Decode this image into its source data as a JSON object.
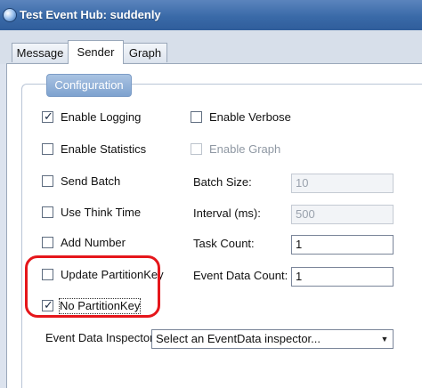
{
  "window": {
    "title": "Test Event Hub: suddenly",
    "icon": "app-globe-icon"
  },
  "tabs": [
    {
      "label": "Message",
      "active": false
    },
    {
      "label": "Sender",
      "active": true
    },
    {
      "label": "Graph",
      "active": false
    }
  ],
  "configuration": {
    "header": "Configuration",
    "left_checkboxes": [
      {
        "label": "Enable Logging",
        "checked": true,
        "enabled": true
      },
      {
        "label": "Enable Statistics",
        "checked": false,
        "enabled": true
      },
      {
        "label": "Send Batch",
        "checked": false,
        "enabled": true
      },
      {
        "label": "Use Think Time",
        "checked": false,
        "enabled": true
      },
      {
        "label": "Add Number",
        "checked": false,
        "enabled": true
      },
      {
        "label": "Update PartitionKey",
        "checked": false,
        "enabled": true
      },
      {
        "label": "No PartitionKey",
        "checked": true,
        "enabled": true
      }
    ],
    "right_checkboxes": [
      {
        "label": "Enable Verbose",
        "checked": false,
        "enabled": true
      },
      {
        "label": "Enable Graph",
        "checked": false,
        "enabled": false
      }
    ],
    "fields": [
      {
        "label": "Batch Size:",
        "value": "10",
        "enabled": false
      },
      {
        "label": "Interval (ms):",
        "value": "500",
        "enabled": false
      },
      {
        "label": "Task Count:",
        "value": "1",
        "enabled": true
      },
      {
        "label": "Event Data Count:",
        "value": "1",
        "enabled": true
      }
    ],
    "inspector": {
      "label": "Event Data Inspector:",
      "selected": "Select an EventData inspector..."
    }
  },
  "glyphs": {
    "check": "✓",
    "dropdown": "▼"
  },
  "colors": {
    "titlebar": "#3a6aa8",
    "highlight": "#e5161b",
    "header": "#7ea2cf"
  }
}
